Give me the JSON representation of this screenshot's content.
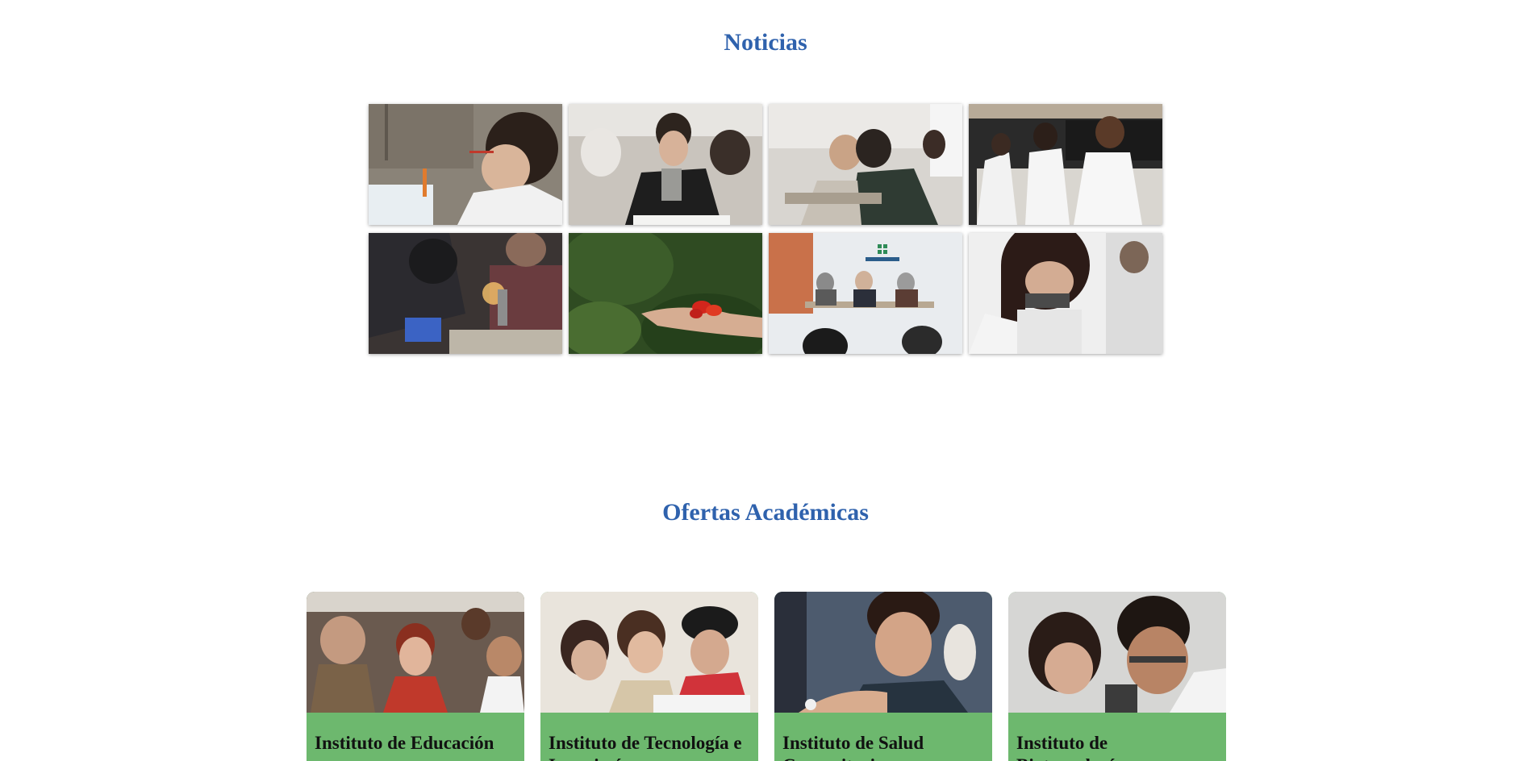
{
  "news": {
    "title": "Noticias",
    "items": [
      {
        "photo": "student-test-tube-lab-photo"
      },
      {
        "photo": "students-classroom-writing-photo"
      },
      {
        "photo": "students-table-study-photo"
      },
      {
        "photo": "lab-coat-researchers-photo"
      },
      {
        "photo": "student-welding-workshop-photo"
      },
      {
        "photo": "hand-holding-peppers-plant-photo"
      },
      {
        "photo": "press-conference-panel-photo"
      },
      {
        "photo": "student-microscope-photo"
      }
    ]
  },
  "offers": {
    "title": "Ofertas Académicas",
    "cards": [
      {
        "title": "Instituto de Educación",
        "photo": "smiling-students-group-photo"
      },
      {
        "title": "Instituto de Tecnología e Ingeniería",
        "photo": "students-cap-notebook-photo"
      },
      {
        "title": "Instituto de Salud Comunitaria",
        "photo": "student-anatomy-model-photo"
      },
      {
        "title": "Instituto de Biotecnología",
        "photo": "students-microscope-lab-photo"
      }
    ]
  },
  "colors": {
    "heading": "#2f62ad",
    "card_green": "#6db86e"
  }
}
